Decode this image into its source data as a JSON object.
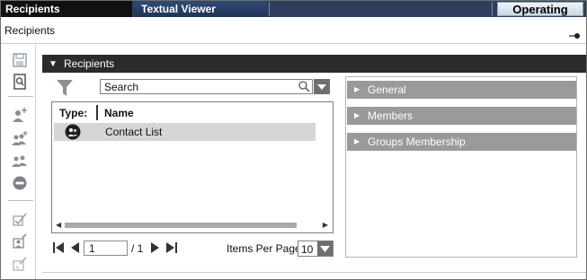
{
  "tabs": {
    "recipients": "Recipients",
    "textual_viewer": "Textual Viewer",
    "operating": "Operating"
  },
  "page": {
    "title": "Recipients"
  },
  "toolbar": {
    "icons": [
      "save-icon",
      "preview-icon",
      "add-user-icon",
      "add-group-icon",
      "group-icon",
      "remove-icon",
      "check-edit-icon",
      "edit-user-icon",
      "edit-disabled-icon"
    ]
  },
  "group": {
    "title": "Recipients"
  },
  "search": {
    "placeholder": "Search"
  },
  "list": {
    "columns": {
      "type": "Type:",
      "name": "Name"
    },
    "rows": [
      {
        "name": "Contact List",
        "icon": "contact-list-icon"
      }
    ]
  },
  "pager": {
    "current_page": "1",
    "total_pages": "/ 1",
    "items_per_page_label": "Items Per Page:",
    "items_per_page_value": "10"
  },
  "details": {
    "sections": [
      "General",
      "Members",
      "Groups Membership"
    ]
  },
  "colors": {
    "header_dark": "#2b2b2b",
    "tab_blue": "#2e3f5c",
    "section_gray": "#9a9a9a",
    "selected_row": "#d5d5d5"
  }
}
